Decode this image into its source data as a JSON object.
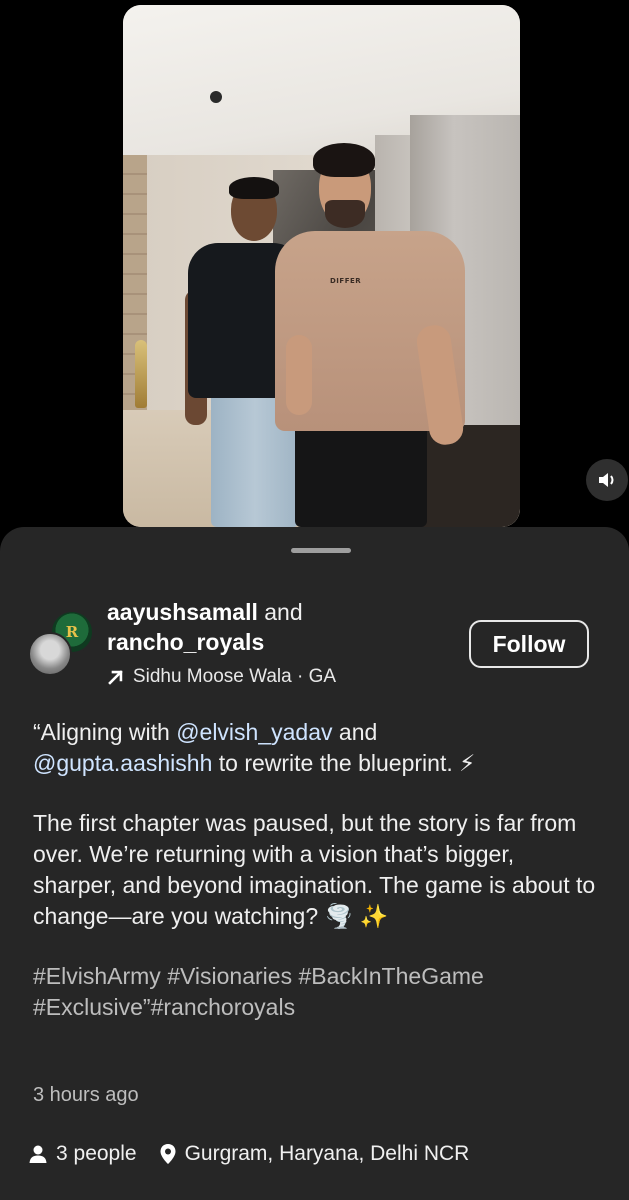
{
  "post": {
    "shirt_text": "DIFFER",
    "authors": {
      "primary": "aayushsamall",
      "connector": "and",
      "secondary": "rancho_royals"
    },
    "audio": {
      "icon": "arrow-up-right-icon",
      "text": "Sidhu Moose Wala · GA"
    },
    "follow_label": "Follow",
    "caption": {
      "line1_prefix": "“Aligning with ",
      "mention1": "@elvish_yadav",
      "line1_mid": " and ",
      "mention2": "@gupta.aashishh",
      "line1_suffix": " to rewrite the blueprint. ⚡",
      "paragraph2": "The first chapter was paused, but the story is far from over. We’re returning with a vision that’s bigger, sharper, and beyond imagination. The game is about to change—are you watching? 🌪️ ✨",
      "hashtags": "#ElvishArmy #Visionaries #BackInTheGame #Exclusive”#ranchoroyals"
    },
    "timestamp": "3 hours ago",
    "tagged_people": "3 people",
    "location": "Gurgram, Haryana, Delhi NCR"
  },
  "icons": {
    "mute": "speaker-icon",
    "people": "person-icon",
    "location": "location-pin-icon"
  },
  "colors": {
    "sheet_bg": "#262626",
    "mention": "#cfe4ff",
    "muted_text": "#bdbdbd"
  }
}
